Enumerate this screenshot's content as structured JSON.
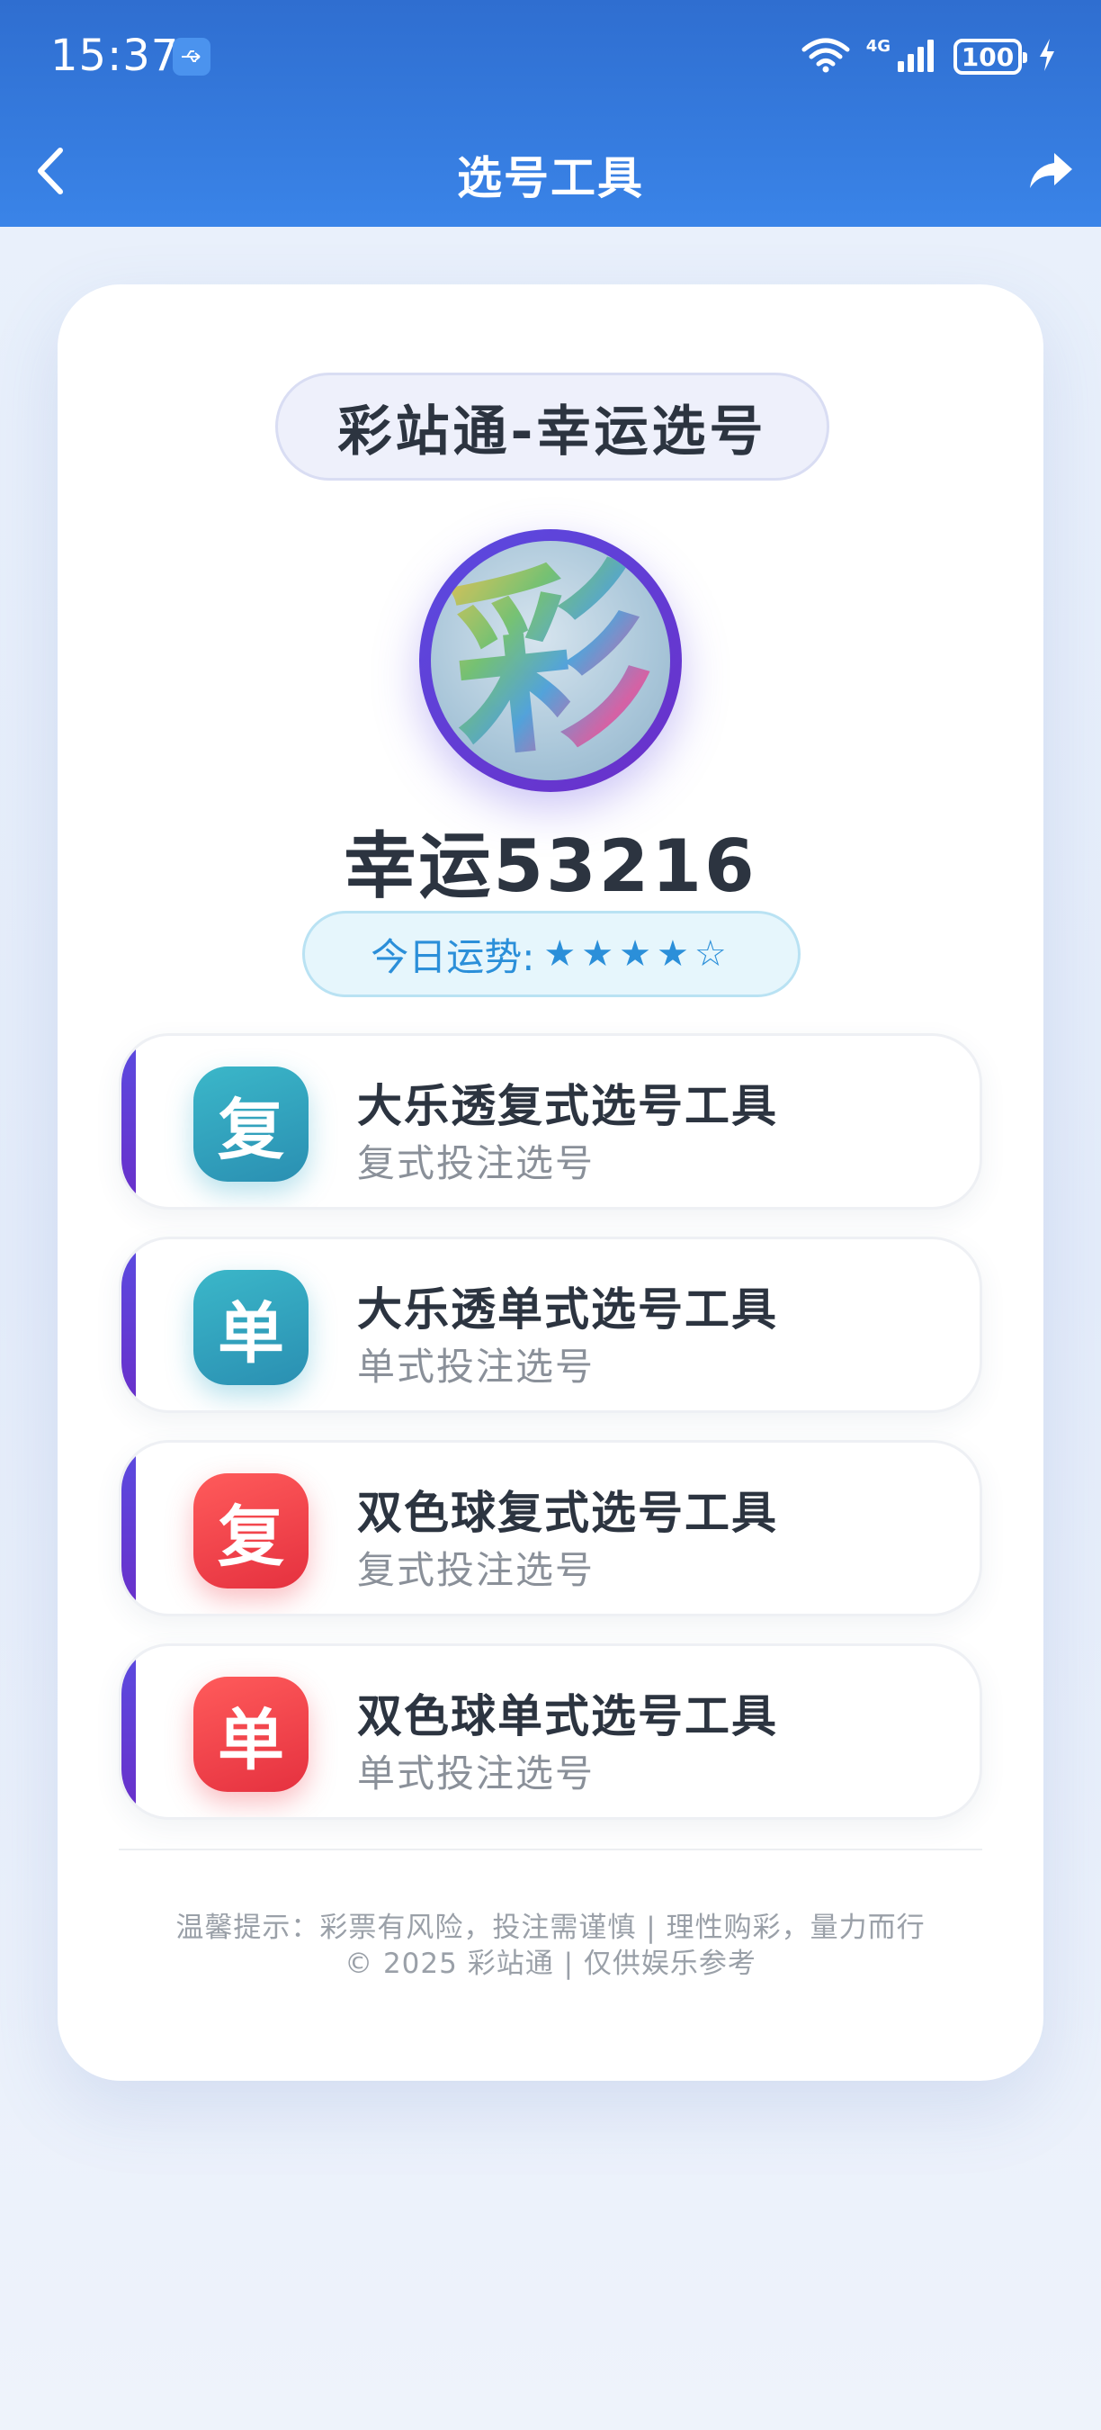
{
  "status_bar": {
    "time": "15:37",
    "network": "4G",
    "battery": "100"
  },
  "nav": {
    "title": "选号工具"
  },
  "card": {
    "brand": "彩站通-幸运选号",
    "avatar_char": "彩",
    "username": "幸运53216",
    "fortune_label": "今日运势:",
    "fortune_stars": "★★★★☆",
    "fortune_rating": 4,
    "fortune_max": 5
  },
  "tools": [
    {
      "icon_char": "复",
      "title": "大乐透复式选号工具",
      "subtitle": "复式投注选号",
      "color": "#2a9fbc"
    },
    {
      "icon_char": "单",
      "title": "大乐透单式选号工具",
      "subtitle": "单式投注选号",
      "color": "#2a9fbc"
    },
    {
      "icon_char": "复",
      "title": "双色球复式选号工具",
      "subtitle": "复式投注选号",
      "color": "#ef3d48"
    },
    {
      "icon_char": "单",
      "title": "双色球单式选号工具",
      "subtitle": "单式投注选号",
      "color": "#ef3d48"
    }
  ],
  "footer": {
    "tip": "温馨提示：彩票有风险，投注需谨慎 | 理性购彩，量力而行",
    "copyright": "© 2025 彩站通 | 仅供娱乐参考"
  },
  "colors": {
    "header": "#3378dd",
    "accent_purple": "#5a4be0",
    "text_dark": "#2c3440",
    "fortune_blue": "#2b8fd9"
  }
}
